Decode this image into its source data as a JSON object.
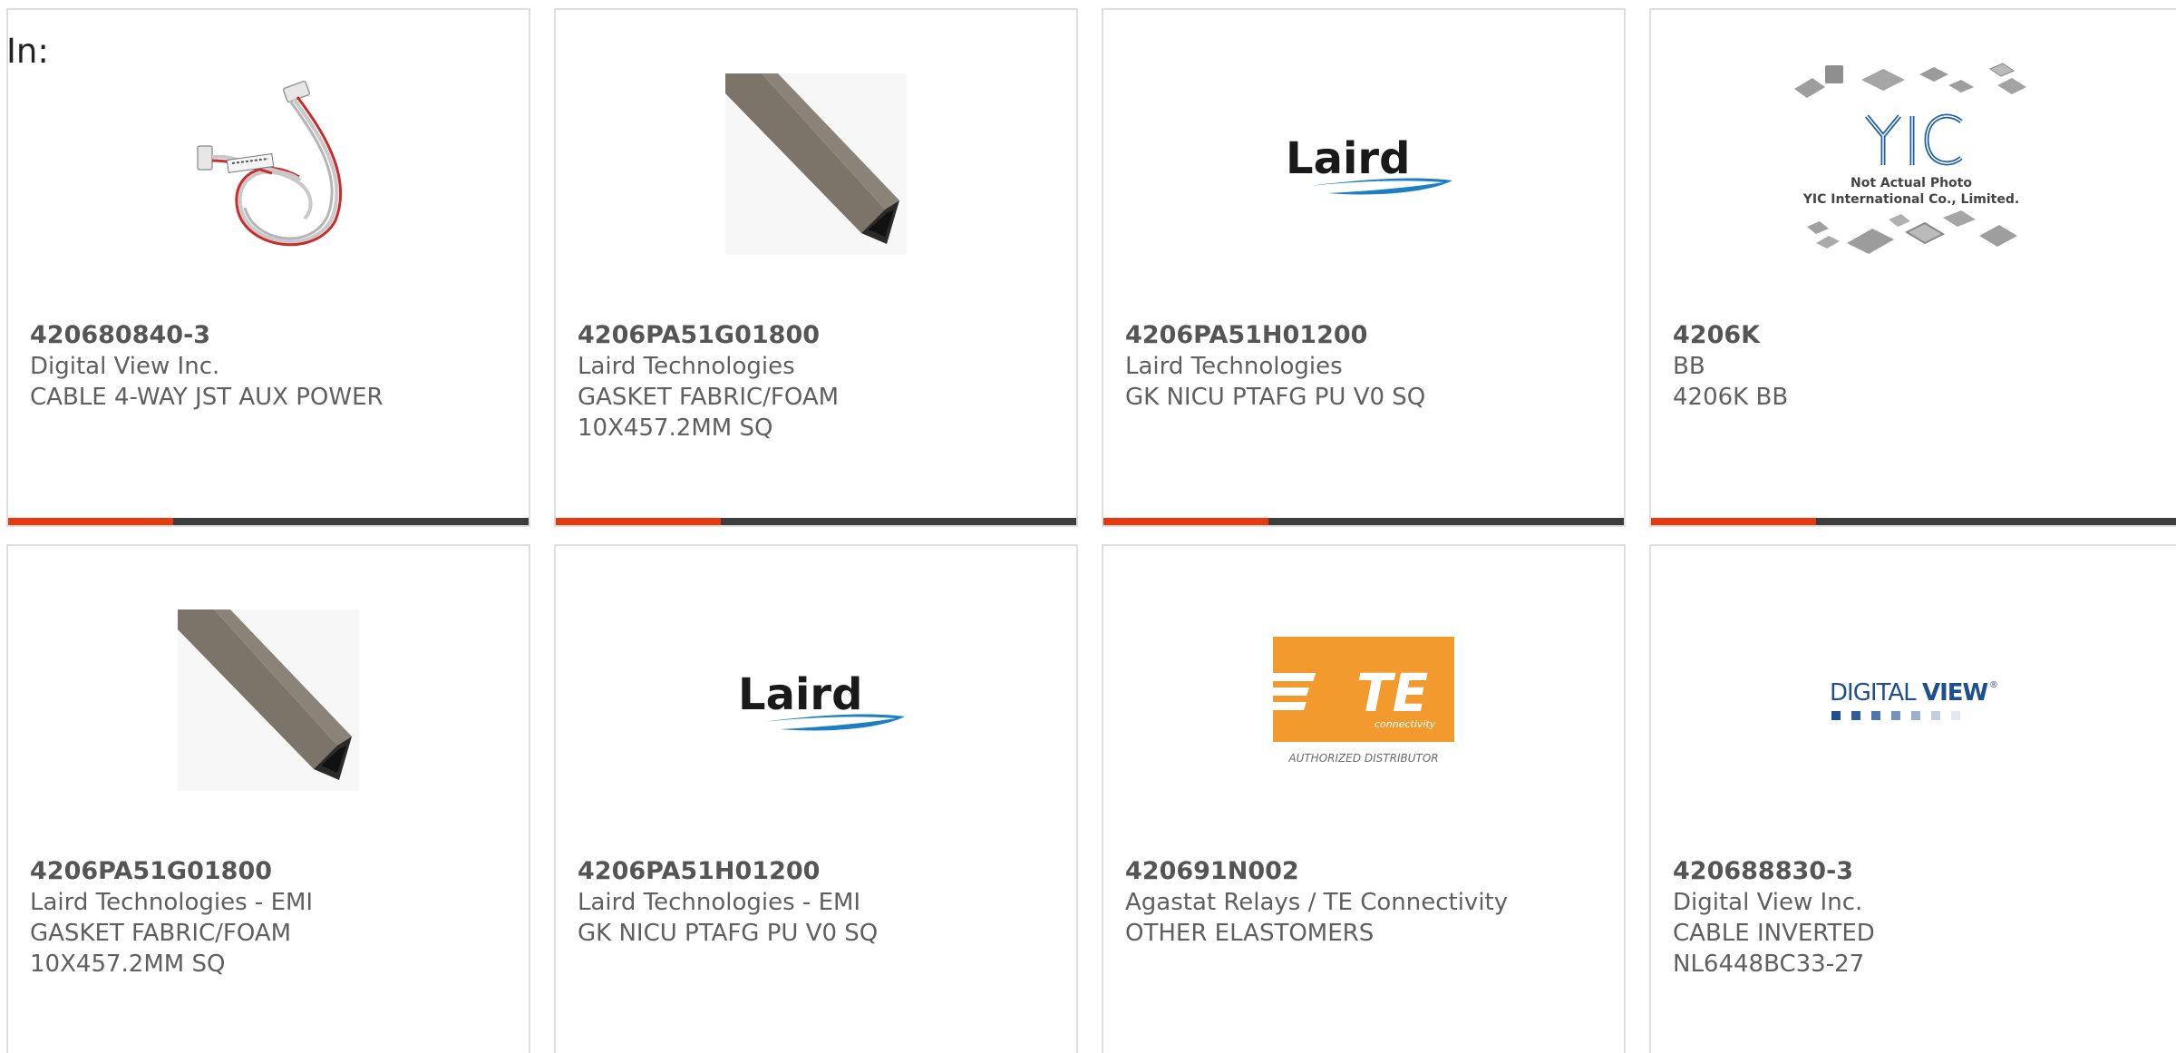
{
  "header": {
    "in_label": "In:"
  },
  "accent_color": "#e8380d",
  "bar_color": "#3d3d3d",
  "products": [
    {
      "part_number": "420680840-3",
      "manufacturer": "Digital View Inc.",
      "description": "CABLE 4-WAY JST AUX POWER",
      "image": "cable-assembly-photo"
    },
    {
      "part_number": "4206PA51G01800",
      "manufacturer": "Laird Technologies",
      "description": "GASKET FABRIC/FOAM 10X457.2MM SQ",
      "image": "gasket-strip-photo"
    },
    {
      "part_number": "4206PA51H01200",
      "manufacturer": "Laird Technologies",
      "description": "GK NICU PTAFG PU V0 SQ",
      "image": "laird-logo",
      "logo_text": "Laird"
    },
    {
      "part_number": "4206K",
      "manufacturer": "BB",
      "description": "4206K BB",
      "image": "yic-placeholder",
      "placeholder_line1": "Not Actual Photo",
      "placeholder_line2": "YIC International Co., Limited."
    },
    {
      "part_number": "4206PA51G01800",
      "manufacturer": "Laird Technologies - EMI",
      "description": "GASKET FABRIC/FOAM 10X457.2MM SQ",
      "image": "gasket-strip-photo"
    },
    {
      "part_number": "4206PA51H01200",
      "manufacturer": "Laird Technologies - EMI",
      "description": "GK NICU PTAFG PU V0 SQ",
      "image": "laird-logo",
      "logo_text": "Laird"
    },
    {
      "part_number": "420691N002",
      "manufacturer": "Agastat Relays / TE Connectivity",
      "description": "OTHER ELASTOMERS",
      "image": "te-connectivity-logo",
      "logo_text": "TE",
      "logo_sub": "connectivity",
      "caption": "AUTHORIZED DISTRIBUTOR"
    },
    {
      "part_number": "420688830-3",
      "manufacturer": "Digital View Inc.",
      "description": "CABLE INVERTED NL6448BC33-27",
      "image": "digitalview-logo",
      "logo_text_a": "DIGITAL",
      "logo_text_b": "VIEW",
      "logo_mark": "®"
    }
  ]
}
